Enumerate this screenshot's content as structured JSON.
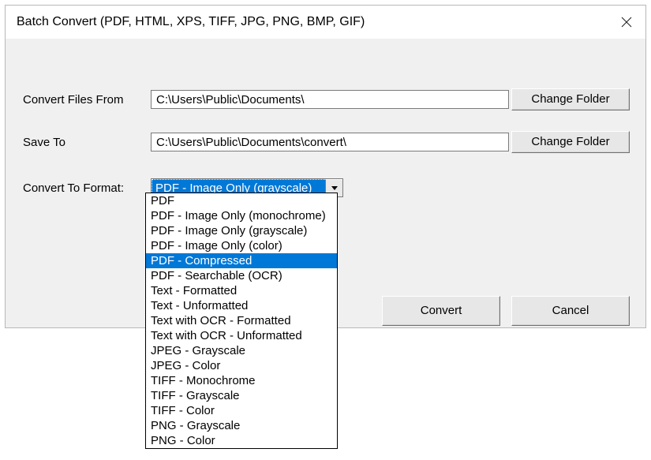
{
  "window": {
    "title": "Batch Convert (PDF, HTML, XPS, TIFF, JPG, PNG, BMP, GIF)"
  },
  "labels": {
    "convert_from": "Convert Files From",
    "save_to": "Save To",
    "convert_format": "Convert To Format:"
  },
  "fields": {
    "from_path": "C:\\Users\\Public\\Documents\\",
    "save_path": "C:\\Users\\Public\\Documents\\convert\\",
    "format_selected": "PDF - Image Only (grayscale)"
  },
  "buttons": {
    "change_folder": "Change Folder",
    "convert": "Convert",
    "cancel": "Cancel"
  },
  "dropdown": {
    "highlight_index": 4,
    "items": [
      "PDF",
      "PDF - Image Only (monochrome)",
      "PDF - Image Only (grayscale)",
      "PDF - Image Only (color)",
      "PDF - Compressed",
      "PDF - Searchable (OCR)",
      "Text - Formatted",
      "Text - Unformatted",
      "Text with OCR - Formatted",
      "Text with OCR - Unformatted",
      "JPEG - Grayscale",
      "JPEG - Color",
      "TIFF - Monochrome",
      "TIFF - Grayscale",
      "TIFF - Color",
      "PNG - Grayscale",
      "PNG - Color"
    ]
  }
}
